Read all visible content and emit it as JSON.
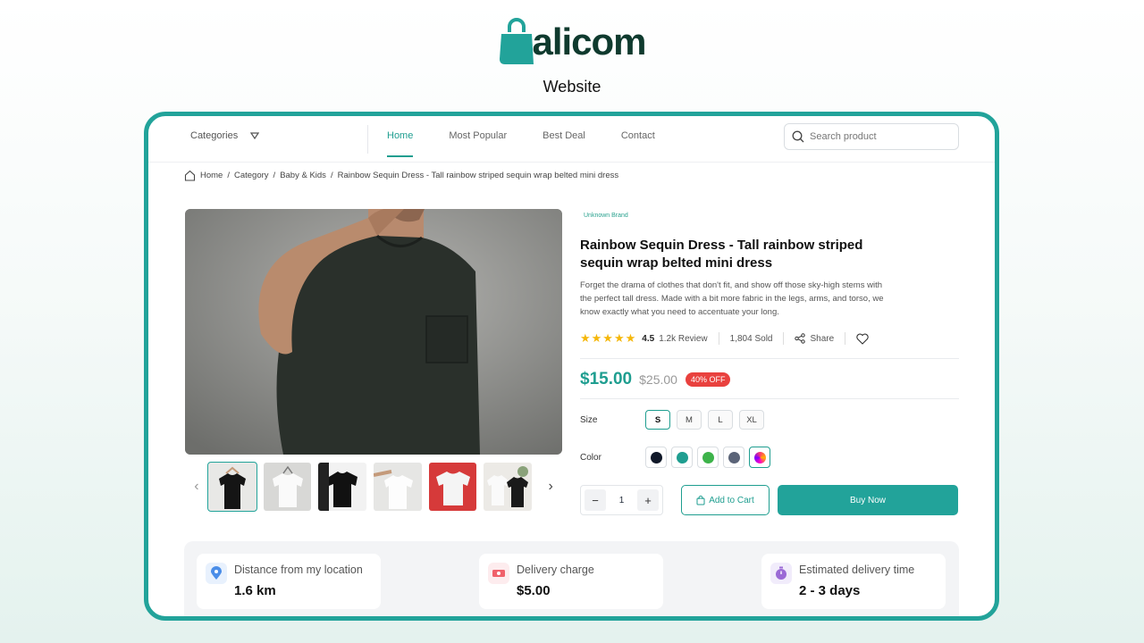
{
  "branding": {
    "logo_text": "alicom",
    "subtitle": "Website"
  },
  "nav": {
    "categories_label": "Categories",
    "links": [
      "Home",
      "Most Popular",
      "Best Deal",
      "Contact"
    ],
    "active_link": "Home",
    "search_placeholder": "Search product"
  },
  "breadcrumb": [
    "Home",
    "Category",
    "Baby & Kids",
    "Rainbow Sequin Dress - Tall rainbow striped sequin wrap belted mini dress"
  ],
  "product": {
    "brand": "Unknown Brand",
    "title": "Rainbow Sequin Dress - Tall rainbow striped sequin wrap belted mini dress",
    "description": "Forget the drama of clothes that don't fit, and show off those sky-high stems with the perfect tall dress. Made with a bit more fabric in the legs, arms, and torso, we know exactly what you need to accentuate your long.",
    "rating": "4.5",
    "rating_value": 4.5,
    "reviews": "1.2k Review",
    "sold": "1,804 Sold",
    "share_label": "Share",
    "price": "$15.00",
    "old_price": "$25.00",
    "discount": "40% OFF",
    "size_label": "Size",
    "sizes": [
      "S",
      "M",
      "L",
      "XL"
    ],
    "selected_size": "S",
    "color_label": "Color",
    "colors": [
      "#101828",
      "#1f9e90",
      "#3db34a",
      "#5b6478",
      "conic"
    ],
    "selected_color_index": 4,
    "quantity": "1",
    "add_to_cart_label": "Add to Cart",
    "buy_now_label": "Buy Now",
    "thumbnails": [
      "black-tshirt-hanger",
      "white-tshirt-hanger",
      "black-tshirt-flat",
      "white-tshirt-hand",
      "white-tshirt-red-bg",
      "tshirts-on-rack"
    ]
  },
  "delivery": [
    {
      "label": "Distance from my location",
      "value": "1.6 km",
      "icon": "location-pin-icon"
    },
    {
      "label": "Delivery charge",
      "value": "$5.00",
      "icon": "cash-icon"
    },
    {
      "label": "Estimated delivery time",
      "value": "2 - 3 days",
      "icon": "stopwatch-icon"
    }
  ],
  "colors": {
    "accent": "#22a39a",
    "discount": "#e9413e",
    "logo_dark": "#0f3a2e"
  }
}
